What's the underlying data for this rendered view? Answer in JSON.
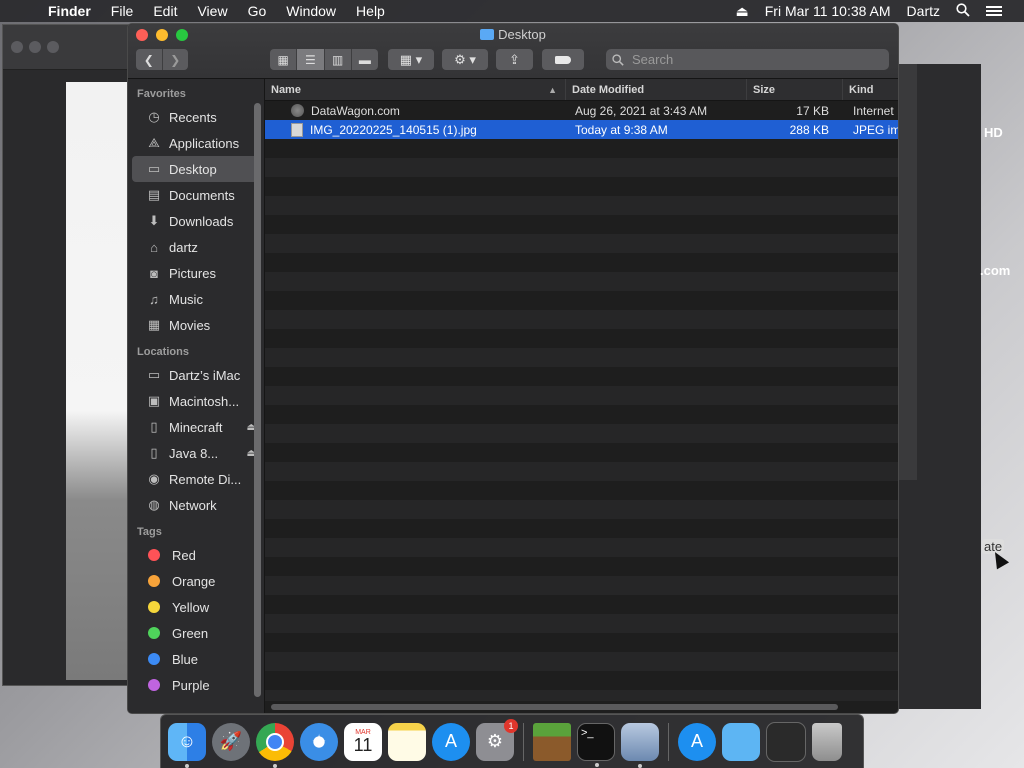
{
  "menubar": {
    "app": "Finder",
    "menus": [
      "File",
      "Edit",
      "View",
      "Go",
      "Window",
      "Help"
    ],
    "clock": "Fri Mar 11  10:38 AM",
    "user": "Dartz"
  },
  "window": {
    "title": "Desktop"
  },
  "search": {
    "placeholder": "Search"
  },
  "sidebar": {
    "favorites_header": "Favorites",
    "favorites": [
      {
        "label": "Recents",
        "icon": "clock-icon"
      },
      {
        "label": "Applications",
        "icon": "applications-icon"
      },
      {
        "label": "Desktop",
        "icon": "desktop-icon"
      },
      {
        "label": "Documents",
        "icon": "document-icon"
      },
      {
        "label": "Downloads",
        "icon": "download-icon"
      },
      {
        "label": "dartz",
        "icon": "home-icon"
      },
      {
        "label": "Pictures",
        "icon": "camera-icon"
      },
      {
        "label": "Music",
        "icon": "music-icon"
      },
      {
        "label": "Movies",
        "icon": "film-icon"
      }
    ],
    "locations_header": "Locations",
    "locations": [
      {
        "label": "Dartz’s iMac",
        "icon": "imac-icon"
      },
      {
        "label": "Macintosh...",
        "icon": "disk-icon"
      },
      {
        "label": "Minecraft",
        "icon": "disk-icon"
      },
      {
        "label": "Java 8...",
        "icon": "disk-icon"
      },
      {
        "label": "Remote Di...",
        "icon": "disc-icon"
      },
      {
        "label": "Network",
        "icon": "globe-icon"
      }
    ],
    "tags_header": "Tags",
    "tags": [
      {
        "label": "Red",
        "color": "#ff5257"
      },
      {
        "label": "Orange",
        "color": "#f7a33a"
      },
      {
        "label": "Yellow",
        "color": "#f5d63b"
      },
      {
        "label": "Green",
        "color": "#4fd35b"
      },
      {
        "label": "Blue",
        "color": "#3c8bf5"
      },
      {
        "label": "Purple",
        "color": "#c064e0"
      }
    ]
  },
  "columns": {
    "name": "Name",
    "date": "Date Modified",
    "size": "Size",
    "kind": "Kind"
  },
  "files": [
    {
      "name": "DataWagon.com",
      "date": "Aug 26, 2021 at 3:43 AM",
      "size": "17 KB",
      "kind": "Internet"
    },
    {
      "name": "IMG_20220225_140515 (1).jpg",
      "date": "Today at 9:38 AM",
      "size": "288 KB",
      "kind": "JPEG im"
    }
  ],
  "desktop_labels": {
    "hd": "HD",
    "com": ".com",
    "ate": "ate"
  },
  "dock": {
    "apps": [
      "Finder",
      "Launchpad",
      "Chrome",
      "Safari",
      "Calendar",
      "Notes",
      "App Store",
      "System Preferences",
      "Minecraft",
      "Terminal",
      "Preview",
      "App Store",
      "Folder",
      "Activity",
      "Trash"
    ],
    "calendar_month": "MAR",
    "calendar_day": "11",
    "sysprefs_badge": "1"
  }
}
